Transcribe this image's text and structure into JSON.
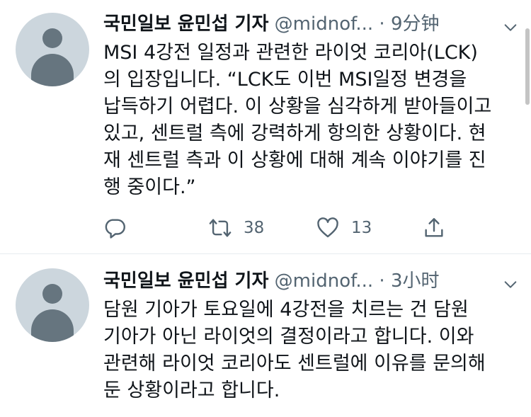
{
  "tweets": [
    {
      "name": "국민일보 윤민섭 기자",
      "handle": "@midnof...",
      "separator": "·",
      "time": "9分钟",
      "text": "MSI 4강전 일정과 관련한 라이엇 코리아(LCK)\n의 입장입니다. “LCK도 이번 MSI일정 변경을\n납득하기 어렵다. 이 상황을 심각하게 받아들이고\n있고, 센트럴 측에 강력하게 항의한 상황이다. 현\n재 센트럴 측과 이 상황에 대해 계속 이야기를 진\n행 중이다.”",
      "actions": {
        "retweets": "38",
        "likes": "13"
      }
    },
    {
      "name": "국민일보 윤민섭 기자",
      "handle": "@midnof...",
      "separator": "·",
      "time": "3小时",
      "text": "담원 기아가 토요일에 4강전을 치르는 건 담원\n기아가 아닌 라이엇의 결정이라고 합니다. 이와\n관련해 라이엇 코리아도 센트럴에 이유를 문의해\n둔 상황이라고 합니다."
    }
  ],
  "icons": {
    "reply": "reply-icon",
    "retweet": "retweet-icon",
    "like": "heart-icon",
    "share": "share-icon",
    "more": "chevron-down-icon"
  },
  "colors": {
    "text": "#0f1419",
    "secondary": "#536471",
    "avatar_bg": "#ccd6dd",
    "avatar_fg": "#66757f",
    "divider": "#e6ecf0"
  }
}
